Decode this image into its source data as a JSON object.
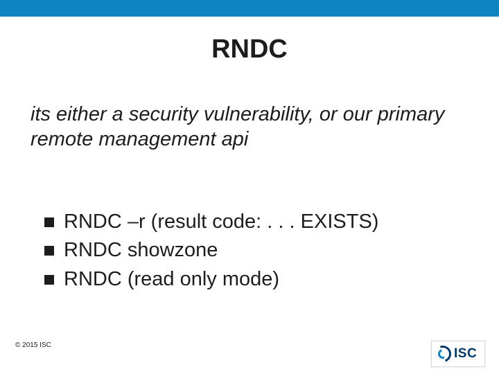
{
  "slide": {
    "title": "RNDC",
    "subtitle": "its either a security vulnerability, or our primary remote management api",
    "bullets": [
      "RNDC –r (result code: . . . EXISTS)",
      "RNDC showzone",
      "RNDC (read only mode)"
    ],
    "copyright": "© 2015 ISC",
    "logo_text": "ISC"
  }
}
